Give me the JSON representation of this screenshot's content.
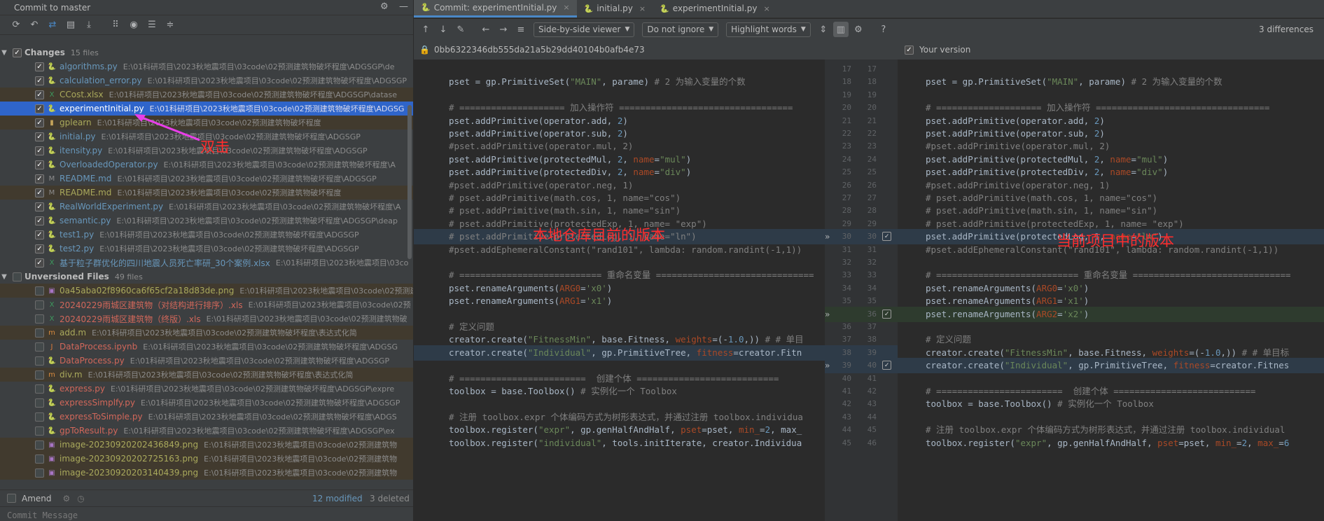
{
  "left_panel": {
    "title": "Commit to master",
    "changes_group": {
      "label": "Changes",
      "count": "15 files"
    },
    "unversioned_group": {
      "label": "Unversioned Files",
      "count": "49 files"
    },
    "changes": [
      {
        "name": "algorithms.py",
        "path": "E:\\01科研项目\\2023秋地震项目\\03code\\02预测建筑物破坏程度\\ADGSGP\\de",
        "status": "mod",
        "icon": "python-file-icon"
      },
      {
        "name": "calculation_error.py",
        "path": "E:\\01科研项目\\2023秋地震项目\\03code\\02预测建筑物破坏程度\\ADGSGP",
        "status": "mod",
        "icon": "python-file-icon"
      },
      {
        "name": "CCost.xlsx",
        "path": "E:\\01科研项目\\2023秋地震项目\\03code\\02预测建筑物破坏程度\\ADGSGP\\datase",
        "status": "ign",
        "icon": "excel-file-icon"
      },
      {
        "name": "experimentInitial.py",
        "path": "E:\\01科研项目\\2023秋地震项目\\03code\\02预测建筑物破坏程度\\ADGSG",
        "status": "sel",
        "icon": "python-file-icon"
      },
      {
        "name": "gplearn",
        "path": "E:\\01科研项目\\2023秋地震项目\\03code\\02预测建筑物破坏程度",
        "status": "ign",
        "icon": "folder-icon"
      },
      {
        "name": "initial.py",
        "path": "E:\\01科研项目\\2023秋地震项目\\03code\\02预测建筑物破坏程度\\ADGSGP",
        "status": "mod",
        "icon": "python-file-icon"
      },
      {
        "name": "itensity.py",
        "path": "E:\\01科研项目\\2023秋地震项目\\03code\\02预测建筑物破坏程度\\ADGSGP",
        "status": "mod",
        "icon": "python-file-icon"
      },
      {
        "name": "OverloadedOperator.py",
        "path": "E:\\01科研项目\\2023秋地震项目\\03code\\02预测建筑物破坏程度\\A",
        "status": "mod",
        "icon": "python-file-icon"
      },
      {
        "name": "README.md",
        "path": "E:\\01科研项目\\2023秋地震项目\\03code\\02预测建筑物破坏程度\\ADGSGP",
        "status": "mod",
        "icon": "markdown-file-icon"
      },
      {
        "name": "README.md",
        "path": "E:\\01科研项目\\2023秋地震项目\\03code\\02预测建筑物破坏程度",
        "status": "ign",
        "icon": "markdown-file-icon"
      },
      {
        "name": "RealWorldExperiment.py",
        "path": "E:\\01科研项目\\2023秋地震项目\\03code\\02预测建筑物破坏程度\\A",
        "status": "mod",
        "icon": "python-file-icon"
      },
      {
        "name": "semantic.py",
        "path": "E:\\01科研项目\\2023秋地震项目\\03code\\02预测建筑物破坏程度\\ADGSGP\\deap",
        "status": "mod",
        "icon": "python-file-icon"
      },
      {
        "name": "test1.py",
        "path": "E:\\01科研项目\\2023秋地震项目\\03code\\02预测建筑物破坏程度\\ADGSGP",
        "status": "mod",
        "icon": "python-file-icon"
      },
      {
        "name": "test2.py",
        "path": "E:\\01科研项目\\2023秋地震项目\\03code\\02预测建筑物破坏程度\\ADGSGP",
        "status": "mod",
        "icon": "python-file-icon"
      },
      {
        "name": "基于粒子群优化的四川地震人员死亡率研_30个案例.xlsx",
        "path": "E:\\01科研项目\\2023秋地震项目\\03co",
        "status": "mod",
        "icon": "excel-file-icon"
      }
    ],
    "unversioned": [
      {
        "name": "0a45aba02f8960ca6f65cf2a18d83de.png",
        "path": "E:\\01科研项目\\2023秋地震项目\\03code\\02预测建",
        "status": "ign",
        "icon": "image-file-icon"
      },
      {
        "name": "20240229雨城区建筑物（对结构进行排序）.xls",
        "path": "E:\\01科研项目\\2023秋地震项目\\03code\\02预",
        "status": "unv",
        "icon": "excel-file-icon"
      },
      {
        "name": "20240229雨城区建筑物（终版）.xls",
        "path": "E:\\01科研项目\\2023秋地震项目\\03code\\02预测建筑物破",
        "status": "unv",
        "icon": "excel-file-icon"
      },
      {
        "name": "add.m",
        "path": "E:\\01科研项目\\2023秋地震项目\\03code\\02预测建筑物破坏程度\\表达式化简",
        "status": "ign",
        "icon": "matlab-file-icon"
      },
      {
        "name": "DataProcess.ipynb",
        "path": "E:\\01科研项目\\2023秋地震项目\\03code\\02预测建筑物破坏程度\\ADGSG",
        "status": "unv",
        "icon": "notebook-file-icon"
      },
      {
        "name": "DataProcess.py",
        "path": "E:\\01科研项目\\2023秋地震项目\\03code\\02预测建筑物破坏程度\\ADGSGP",
        "status": "unv",
        "icon": "python-file-icon"
      },
      {
        "name": "div.m",
        "path": "E:\\01科研项目\\2023秋地震项目\\03code\\02预测建筑物破坏程度\\表达式化简",
        "status": "ign",
        "icon": "matlab-file-icon"
      },
      {
        "name": "express.py",
        "path": "E:\\01科研项目\\2023秋地震项目\\03code\\02预测建筑物破坏程度\\ADGSGP\\expre",
        "status": "unv",
        "icon": "python-file-icon"
      },
      {
        "name": "expressSimplfy.py",
        "path": "E:\\01科研项目\\2023秋地震项目\\03code\\02预测建筑物破坏程度\\ADGSGP",
        "status": "unv",
        "icon": "python-file-icon"
      },
      {
        "name": "expressToSimple.py",
        "path": "E:\\01科研项目\\2023秋地震项目\\03code\\02预测建筑物破坏程度\\ADGS",
        "status": "unv",
        "icon": "python-file-icon"
      },
      {
        "name": "gpToResult.py",
        "path": "E:\\01科研项目\\2023秋地震项目\\03code\\02预测建筑物破坏程度\\ADGSGP\\ex",
        "status": "unv",
        "icon": "python-file-icon"
      },
      {
        "name": "image-20230920202436849.png",
        "path": "E:\\01科研项目\\2023秋地震项目\\03code\\02预测建筑物",
        "status": "ign",
        "icon": "image-file-icon"
      },
      {
        "name": "image-20230920202725163.png",
        "path": "E:\\01科研项目\\2023秋地震项目\\03code\\02预测建筑物",
        "status": "ign",
        "icon": "image-file-icon"
      },
      {
        "name": "image-20230920203140439.png",
        "path": "E:\\01科研项目\\2023秋地震项目\\03code\\02预测建筑物",
        "status": "ign",
        "icon": "image-file-icon"
      }
    ],
    "annotation": "双击",
    "amend_label": "Amend",
    "modified_count": "12 modified",
    "deleted_count": "3 deleted",
    "commit_placeholder": "Commit Message"
  },
  "tabs": [
    {
      "label": "Commit: experimentInitial.py",
      "active": true
    },
    {
      "label": "initial.py",
      "active": false
    },
    {
      "label": "experimentInitial.py",
      "active": false
    }
  ],
  "toolbar": {
    "viewer": "Side-by-side viewer",
    "ignore": "Do not ignore",
    "highlight": "Highlight words",
    "help": "?",
    "differences": "3 differences"
  },
  "diff": {
    "left_hash": "0bb6322346db555da21a5b29dd40104b0afb4e73",
    "right_title": "Your version",
    "left_annotation": "本地仓库目前的版本",
    "right_annotation": "当前项目中的版本",
    "left_lines": [
      {
        "n": "17",
        "t": ""
      },
      {
        "n": "18",
        "t": "pset = gp.PrimitiveSet(\"MAIN\", parame) # 2 为输入变量的个数"
      },
      {
        "n": "19",
        "t": ""
      },
      {
        "n": "20",
        "t": "# ==================== 加入操作符 ================================="
      },
      {
        "n": "21",
        "t": "pset.addPrimitive(operator.add, 2)"
      },
      {
        "n": "22",
        "t": "pset.addPrimitive(operator.sub, 2)"
      },
      {
        "n": "23",
        "t": "#pset.addPrimitive(operator.mul, 2)"
      },
      {
        "n": "24",
        "t": "pset.addPrimitive(protectedMul, 2, name=\"mul\")"
      },
      {
        "n": "25",
        "t": "pset.addPrimitive(protectedDiv, 2, name=\"div\")"
      },
      {
        "n": "26",
        "t": "#pset.addPrimitive(operator.neg, 1)"
      },
      {
        "n": "27",
        "t": "# pset.addPrimitive(math.cos, 1, name=\"cos\")"
      },
      {
        "n": "28",
        "t": "# pset.addPrimitive(math.sin, 1, name=\"sin\")"
      },
      {
        "n": "29",
        "t": "# pset.addPrimitive(protectedExp, 1, name= \"exp\")"
      },
      {
        "n": "30",
        "t": "# pset.addPrimitive(protectedLog, 1, name=\"ln\")",
        "chg": true
      },
      {
        "n": "31",
        "t": "#pset.addEphemeralConstant(\"rand101\", lambda: random.randint(-1,1))"
      },
      {
        "n": "32",
        "t": ""
      },
      {
        "n": "33",
        "t": "# =========================== 重命名变量 =============================="
      },
      {
        "n": "34",
        "t": "pset.renameArguments(ARG0='x0')"
      },
      {
        "n": "35",
        "t": "pset.renameArguments(ARG1='x1')"
      },
      {
        "n": "",
        "t": ""
      },
      {
        "n": "36",
        "t": "# 定义问题"
      },
      {
        "n": "37",
        "t": "creator.create(\"FitnessMin\", base.Fitness, weights=(-1.0,)) # # 单目"
      },
      {
        "n": "38",
        "t": "creator.create(\"Individual\", gp.PrimitiveTree, fitness=creator.Fitn",
        "chg": true
      },
      {
        "n": "39",
        "t": ""
      },
      {
        "n": "40",
        "t": "# ========================  创建个体 ==========================="
      },
      {
        "n": "41",
        "t": "toolbox = base.Toolbox() # 实例化一个 Toolbox"
      },
      {
        "n": "42",
        "t": ""
      },
      {
        "n": "43",
        "t": "# 注册 toolbox.expr 个体编码方式为树形表达式，并通过注册 toolbox.individua"
      },
      {
        "n": "44",
        "t": "toolbox.register(\"expr\", gp.genHalfAndHalf, pset=pset, min_=2, max_"
      },
      {
        "n": "45",
        "t": "toolbox.register(\"individual\", tools.initIterate, creator.Individua"
      }
    ],
    "right_lines": [
      {
        "n": "17",
        "t": ""
      },
      {
        "n": "18",
        "t": "pset = gp.PrimitiveSet(\"MAIN\", parame) # 2 为输入变量的个数"
      },
      {
        "n": "19",
        "t": ""
      },
      {
        "n": "20",
        "t": "# ==================== 加入操作符 ================================="
      },
      {
        "n": "21",
        "t": "pset.addPrimitive(operator.add, 2)"
      },
      {
        "n": "22",
        "t": "pset.addPrimitive(operator.sub, 2)"
      },
      {
        "n": "23",
        "t": "#pset.addPrimitive(operator.mul, 2)"
      },
      {
        "n": "24",
        "t": "pset.addPrimitive(protectedMul, 2, name=\"mul\")"
      },
      {
        "n": "25",
        "t": "pset.addPrimitive(protectedDiv, 2, name=\"div\")"
      },
      {
        "n": "26",
        "t": "#pset.addPrimitive(operator.neg, 1)"
      },
      {
        "n": "27",
        "t": "# pset.addPrimitive(math.cos, 1, name=\"cos\")"
      },
      {
        "n": "28",
        "t": "# pset.addPrimitive(math.sin, 1, name=\"sin\")"
      },
      {
        "n": "29",
        "t": "# pset.addPrimitive(protectedExp, 1, name= \"exp\")"
      },
      {
        "n": "30",
        "t": "pset.addPrimitive(protectedLog, 1, name=\"ln\")",
        "chg": true
      },
      {
        "n": "31",
        "t": "#pset.addEphemeralConstant(\"rand101\", lambda: random.randint(-1,1))"
      },
      {
        "n": "32",
        "t": ""
      },
      {
        "n": "33",
        "t": "# =========================== 重命名变量 =============================="
      },
      {
        "n": "34",
        "t": "pset.renameArguments(ARG0='x0')"
      },
      {
        "n": "35",
        "t": "pset.renameArguments(ARG1='x1')"
      },
      {
        "n": "36",
        "t": "pset.renameArguments(ARG2='x2')",
        "add": true
      },
      {
        "n": "37",
        "t": ""
      },
      {
        "n": "38",
        "t": "# 定义问题"
      },
      {
        "n": "39",
        "t": "creator.create(\"FitnessMin\", base.Fitness, weights=(-1.0,)) # # 单目标"
      },
      {
        "n": "40",
        "t": "creator.create(\"Individual\", gp.PrimitiveTree, fitness=creator.Fitnes",
        "chg": true
      },
      {
        "n": "41",
        "t": ""
      },
      {
        "n": "42",
        "t": "# ========================  创建个体 ==========================="
      },
      {
        "n": "43",
        "t": "toolbox = base.Toolbox() # 实例化一个 Toolbox"
      },
      {
        "n": "44",
        "t": ""
      },
      {
        "n": "45",
        "t": "# 注册 toolbox.expr 个体编码方式为树形表达式，并通过注册 toolbox.individual"
      },
      {
        "n": "46",
        "t": "toolbox.register(\"expr\", gp.genHalfAndHalf, pset=pset, min_=2, max_=6"
      }
    ]
  },
  "colors": {
    "accent": "#4a88c7",
    "selection": "#2f65ca",
    "annotation": "#ff2d2d",
    "changed_bg": "#2e3b48",
    "added_bg": "#2e3b2e"
  }
}
